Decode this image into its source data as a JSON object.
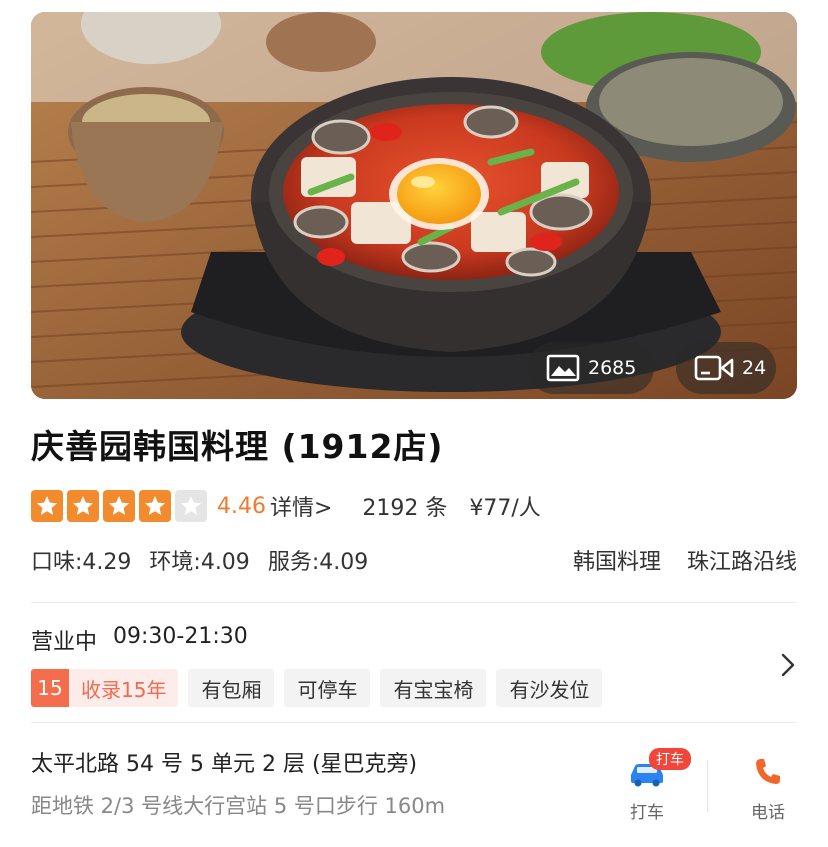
{
  "hero": {
    "photo_count": "2685",
    "video_count": "24",
    "photo_icon": "image-icon",
    "video_icon": "video-icon"
  },
  "title": "庆善园韩国料理 (1912店)",
  "rating": {
    "stars": 4,
    "max_stars": 5,
    "score": "4.46",
    "details_label": "详情>",
    "reviews": "2192 条",
    "price": "¥77/人",
    "star_color": "#f28a2e"
  },
  "subscores": {
    "taste": "口味:4.29",
    "environment": "环境:4.09",
    "service": "服务:4.09"
  },
  "category": "韩国料理",
  "area": "珠江路沿线",
  "hours": {
    "status": "营业中",
    "time": "09:30-21:30"
  },
  "record": {
    "number": "15",
    "label": "收录15年"
  },
  "features": [
    "有包厢",
    "可停车",
    "有宝宝椅",
    "有沙发位"
  ],
  "address": "太平北路 54 号 5 单元 2 层 (星巴克旁)",
  "metro": "距地铁 2/3 号线大行宫站 5 号口步行 160m",
  "actions": {
    "taxi_badge": "打车",
    "taxi_label": "打车",
    "phone_label": "电话"
  },
  "colors": {
    "accent_orange": "#ef7b30",
    "taxi_blue": "#2a84f0",
    "phone_orange": "#f2662b",
    "record_red": "#f46e4d"
  }
}
